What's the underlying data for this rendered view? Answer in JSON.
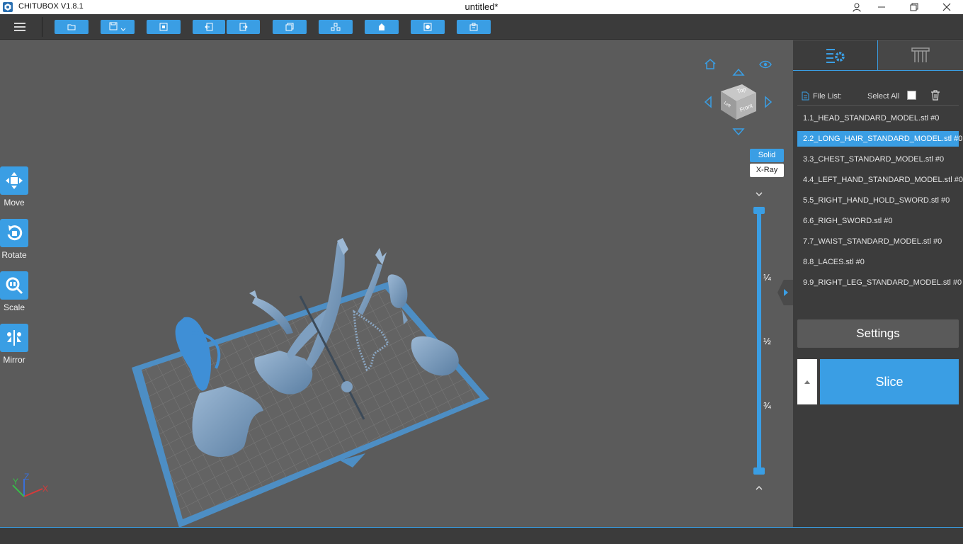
{
  "window": {
    "app_name": "CHITUBOX V1.8.1",
    "document_title": "untitled*",
    "icons": [
      "user-icon",
      "minimize-icon",
      "restore-icon",
      "close-icon"
    ]
  },
  "toolbar": {
    "buttons": [
      "open-file-icon",
      "save-icon",
      "auto-layout-icon",
      "import-icon",
      "export-icon",
      "duplicate-icon",
      "arrange-icon",
      "hollow-icon",
      "drill-icon",
      "print-icon"
    ]
  },
  "tools": [
    {
      "label": "Move",
      "icon": "move-icon"
    },
    {
      "label": "Rotate",
      "icon": "rotate-icon"
    },
    {
      "label": "Scale",
      "icon": "scale-icon"
    },
    {
      "label": "Mirror",
      "icon": "mirror-icon"
    }
  ],
  "view_cube": {
    "faces": {
      "top": "Top",
      "front": "Front",
      "left": "Left"
    }
  },
  "render_modes": {
    "solid": "Solid",
    "xray": "X-Ray",
    "active": "Solid"
  },
  "layer_slider": {
    "marks": [
      "¼",
      "½",
      "¾"
    ],
    "top_value": 1.0,
    "bottom_value": 0.0
  },
  "axes": {
    "x": "X",
    "y": "Y",
    "z": "Z"
  },
  "panel": {
    "file_list_label": "File List:",
    "select_all_label": "Select All",
    "files": [
      "1.1_HEAD_STANDARD_MODEL.stl #0",
      "2.2_LONG_HAIR_STANDARD_MODEL.stl #0",
      "3.3_CHEST_STANDARD_MODEL.stl #0",
      "4.4_LEFT_HAND_STANDARD_MODEL.stl #0",
      "5.5_RIGHT_HAND_HOLD_SWORD.stl #0",
      "6.6_RIGH_SWORD.stl #0",
      "7.7_WAIST_STANDARD_MODEL.stl #0",
      "8.8_LACES.stl #0",
      "9.9_RIGHT_LEG_STANDARD_MODEL.stl #0"
    ],
    "selected_index": 1,
    "settings_label": "Settings",
    "slice_label": "Slice"
  },
  "colors": {
    "accent": "#3a9ee4",
    "background": "#5b5b5b",
    "panel": "#3c3c3c",
    "model": "#6e93b8",
    "plate": "#4d8ec4"
  }
}
